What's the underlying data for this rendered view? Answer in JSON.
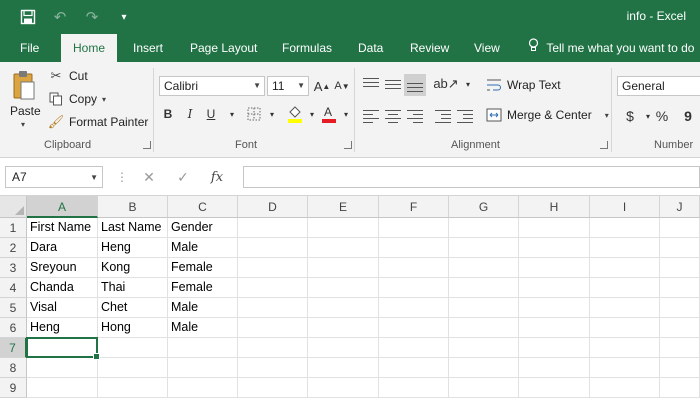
{
  "window": {
    "title": "info - Excel"
  },
  "quick_access": [
    "save-icon",
    "undo-icon",
    "redo-icon",
    "customize-icon"
  ],
  "tabs": [
    {
      "label": "File"
    },
    {
      "label": "Home",
      "active": true
    },
    {
      "label": "Insert"
    },
    {
      "label": "Page Layout"
    },
    {
      "label": "Formulas"
    },
    {
      "label": "Data"
    },
    {
      "label": "Review"
    },
    {
      "label": "View"
    }
  ],
  "tell_me": "Tell me what you want to do",
  "ribbon": {
    "clipboard": {
      "label": "Clipboard",
      "paste": "Paste",
      "cut": "Cut",
      "copy": "Copy",
      "format_painter": "Format Painter"
    },
    "font": {
      "label": "Font",
      "family": "Calibri",
      "size": "11",
      "bold": "B",
      "italic": "I",
      "underline": "U"
    },
    "alignment": {
      "label": "Alignment",
      "wrap_text": "Wrap Text",
      "merge_center": "Merge & Center"
    },
    "number": {
      "label": "Number",
      "format": "General",
      "currency": "$",
      "percent": "%",
      "comma": "9"
    }
  },
  "formula_bar": {
    "name_box": "A7",
    "value": ""
  },
  "columns": [
    "A",
    "B",
    "C",
    "D",
    "E",
    "F",
    "G",
    "H",
    "I",
    "J"
  ],
  "rows": [
    "1",
    "2",
    "3",
    "4",
    "5",
    "6",
    "7",
    "8",
    "9"
  ],
  "cells": [
    [
      "First Name",
      "Last Name",
      "Gender"
    ],
    [
      "Dara",
      "Heng",
      "Male"
    ],
    [
      "Sreyoun",
      "Kong",
      "Female"
    ],
    [
      "Chanda",
      "Thai",
      "Female"
    ],
    [
      "Visal",
      "Chet",
      "Male"
    ],
    [
      "Heng",
      "Hong",
      "Male"
    ]
  ],
  "selected_cell": "A7",
  "colors": {
    "accent": "#217346",
    "ribbon_bg": "#f3f3f3",
    "fill_yellow": "#ffff00",
    "font_red": "#e51c23"
  }
}
